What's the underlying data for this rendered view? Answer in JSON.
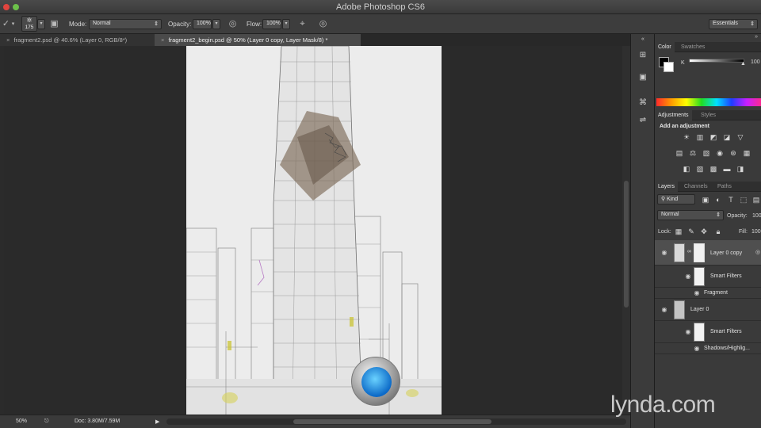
{
  "app": {
    "title": "Adobe Photoshop CS6"
  },
  "options": {
    "brush_size": "175",
    "mode_label": "Mode:",
    "mode_value": "Normal",
    "opacity_label": "Opacity:",
    "opacity_value": "100%",
    "flow_label": "Flow:",
    "flow_value": "100%",
    "workspace": "Essentials"
  },
  "tabs": [
    {
      "label": "fragment2.psd @ 40.6% (Layer 0, RGB/8*)",
      "close": "×",
      "active": false
    },
    {
      "label": "fragment2_begin.psd @ 50% (Layer 0 copy, Layer Mask/8) *",
      "close": "×",
      "active": true
    }
  ],
  "status": {
    "zoom": "50%",
    "doc": "Doc: 3.80M/7.59M"
  },
  "color_panel": {
    "tab_color": "Color",
    "tab_swatches": "Swatches",
    "channel": "K",
    "value": "100"
  },
  "adjustments_panel": {
    "tab_adjustments": "Adjustments",
    "tab_styles": "Styles",
    "hint": "Add an adjustment"
  },
  "layers_panel": {
    "tab_layers": "Layers",
    "tab_channels": "Channels",
    "tab_paths": "Paths",
    "filter_kind": "Kind",
    "blend_mode": "Normal",
    "opacity_label": "Opacity:",
    "opacity_value": "100",
    "lock_label": "Lock:",
    "fill_label": "Fill:",
    "fill_value": "100",
    "layers": [
      {
        "name": "Layer 0 copy",
        "smart_filters": "Smart Filters",
        "filter": "Fragment",
        "selected": true
      },
      {
        "name": "Layer 0",
        "smart_filters": "Smart Filters",
        "filter": "Shadows/Highlig...",
        "selected": false
      }
    ]
  },
  "watermark": "lynda.com",
  "colors": {
    "accent_selected_row": "#4f4f4f",
    "panel_bg": "#3a3a3a",
    "canvas_bg": "#2a2a2a"
  }
}
